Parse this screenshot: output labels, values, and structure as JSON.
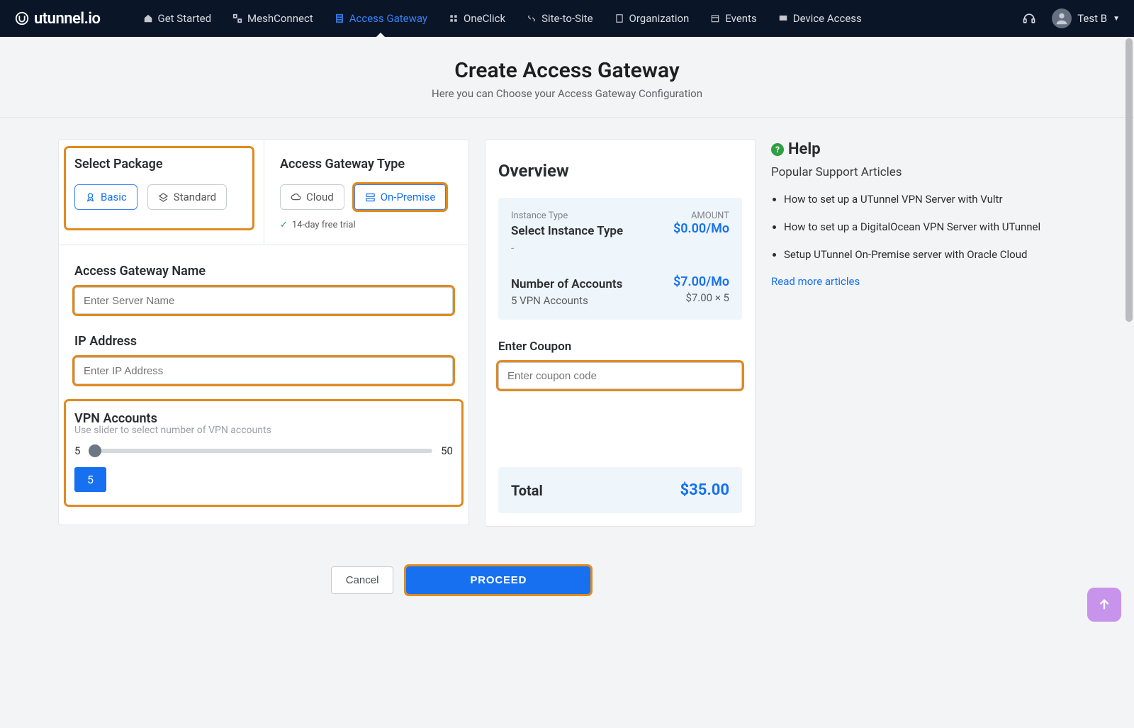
{
  "brand": "utunnel.io",
  "nav": {
    "items": [
      {
        "label": "Get Started",
        "active": false
      },
      {
        "label": "MeshConnect",
        "active": false
      },
      {
        "label": "Access Gateway",
        "active": true
      },
      {
        "label": "OneClick",
        "active": false
      },
      {
        "label": "Site-to-Site",
        "active": false
      },
      {
        "label": "Organization",
        "active": false
      },
      {
        "label": "Events",
        "active": false
      },
      {
        "label": "Device Access",
        "active": false
      }
    ],
    "user": "Test B"
  },
  "header": {
    "title": "Create Access Gateway",
    "subtitle": "Here you can Choose your Access Gateway Configuration"
  },
  "package": {
    "title": "Select Package",
    "basic": "Basic",
    "standard": "Standard"
  },
  "gateway_type": {
    "title": "Access Gateway Type",
    "cloud": "Cloud",
    "onprem": "On-Premise",
    "trial": "14-day free trial"
  },
  "form": {
    "name_label": "Access Gateway Name",
    "name_placeholder": "Enter Server Name",
    "ip_label": "IP Address",
    "ip_placeholder": "Enter IP Address",
    "vpn_label": "VPN Accounts",
    "vpn_hint": "Use slider to select number of VPN accounts",
    "vpn_min": "5",
    "vpn_max": "50",
    "vpn_value": "5"
  },
  "overview": {
    "title": "Overview",
    "instance_label": "Instance Type",
    "amount_label": "AMOUNT",
    "select_instance": "Select Instance Type",
    "dash": "-",
    "instance_price": "$0.00/Mo",
    "accounts_label": "Number of Accounts",
    "accounts_sub": "5 VPN Accounts",
    "accounts_price": "$7.00/Mo",
    "accounts_math": "$7.00 × 5",
    "coupon_label": "Enter Coupon",
    "coupon_placeholder": "Enter coupon code",
    "total_label": "Total",
    "total_price": "$35.00"
  },
  "help": {
    "title": "Help",
    "subtitle": "Popular Support Articles",
    "articles": [
      "How to set up a UTunnel VPN Server with Vultr",
      "How to set up a DigitalOcean VPN Server with UTunnel",
      "Setup UTunnel On-Premise server with Oracle Cloud"
    ],
    "more": "Read more articles"
  },
  "footer": {
    "cancel": "Cancel",
    "proceed": "PROCEED"
  }
}
